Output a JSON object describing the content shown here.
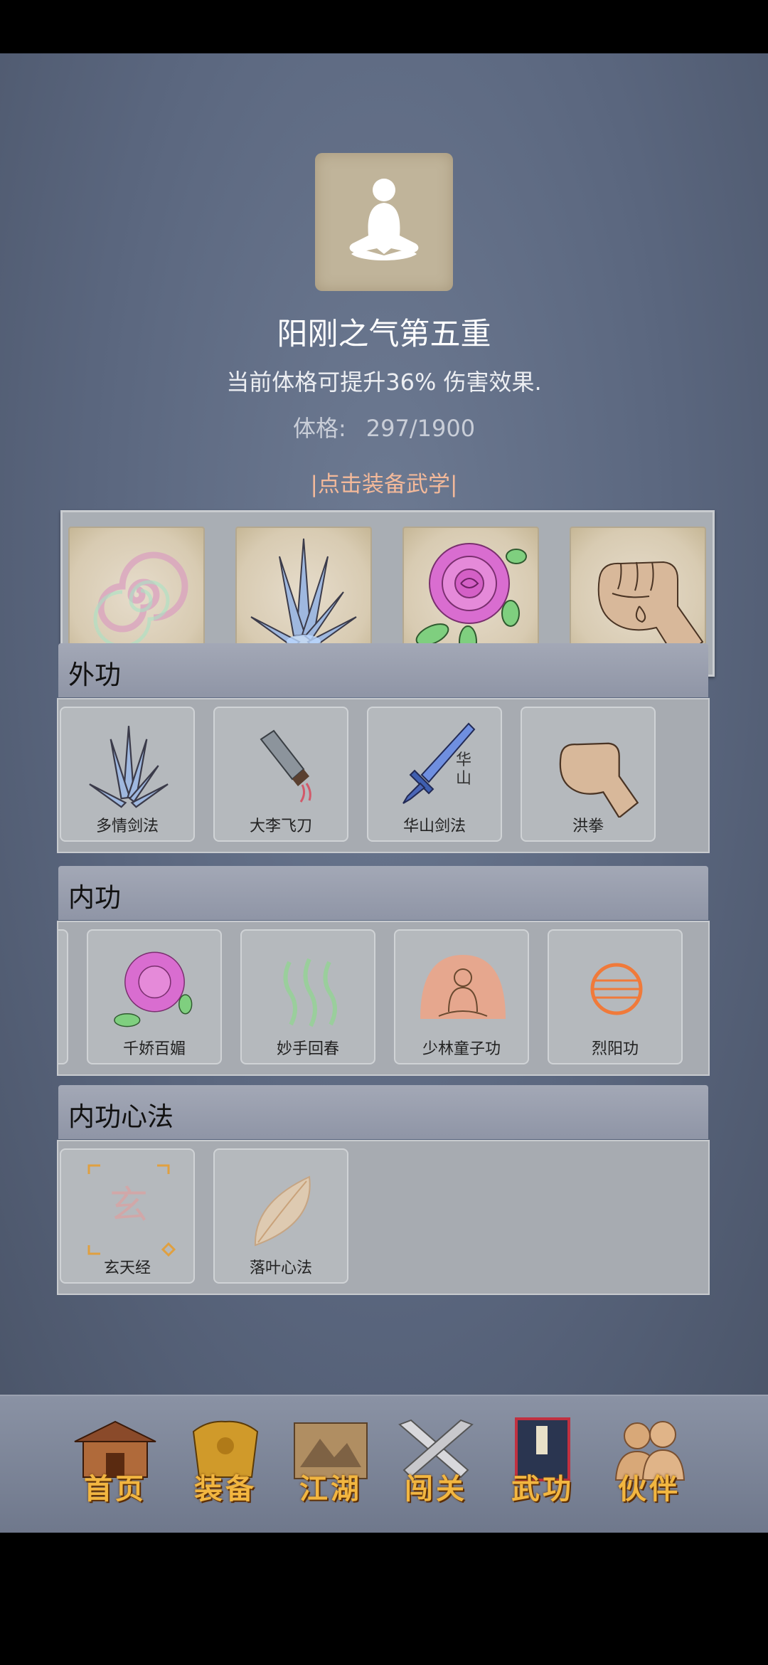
{
  "header": {
    "skill_title": "阳刚之气第五重",
    "description": "当前体格可提升36% 伤害效果.",
    "stat_label": "体格:",
    "stat_value": "297/1900",
    "equip_link": "|点击装备武学|"
  },
  "equipped_slots": [
    {
      "icon": "swirl-icon"
    },
    {
      "icon": "sword-fan-icon"
    },
    {
      "icon": "rose-icon"
    },
    {
      "icon": "fist-icon"
    }
  ],
  "sections": {
    "external": {
      "title": "外功",
      "items": [
        {
          "label": "多情剑法",
          "icon": "sword-fan-icon"
        },
        {
          "label": "大李飞刀",
          "icon": "cleaver-icon"
        },
        {
          "label": "华山剑法",
          "icon": "sword-icon",
          "inscription": "华山"
        },
        {
          "label": "洪拳",
          "icon": "fist-icon"
        }
      ]
    },
    "internal": {
      "title": "内功",
      "items": [
        {
          "label": "千娇百媚",
          "icon": "rose-icon"
        },
        {
          "label": "妙手回春",
          "icon": "green-waves-icon"
        },
        {
          "label": "少林童子功",
          "icon": "meditating-monk-icon"
        },
        {
          "label": "烈阳功",
          "icon": "sun-ball-icon"
        }
      ]
    },
    "mental": {
      "title": "内功心法",
      "items": [
        {
          "label": "玄天经",
          "icon": "xuan-seal-icon",
          "inscription": "玄"
        },
        {
          "label": "落叶心法",
          "icon": "leaf-icon"
        }
      ]
    }
  },
  "nav": {
    "items": [
      {
        "label": "首页",
        "icon": "house-icon"
      },
      {
        "label": "装备",
        "icon": "armor-icon"
      },
      {
        "label": "江湖",
        "icon": "scroll-map-icon"
      },
      {
        "label": "闯关",
        "icon": "crossed-swords-icon"
      },
      {
        "label": "武功",
        "icon": "book-icon"
      },
      {
        "label": "伙伴",
        "icon": "companions-icon"
      }
    ]
  },
  "colors": {
    "background": "#5a667e",
    "accent_link": "#f3b99a",
    "nav_label": "#f2b640"
  }
}
